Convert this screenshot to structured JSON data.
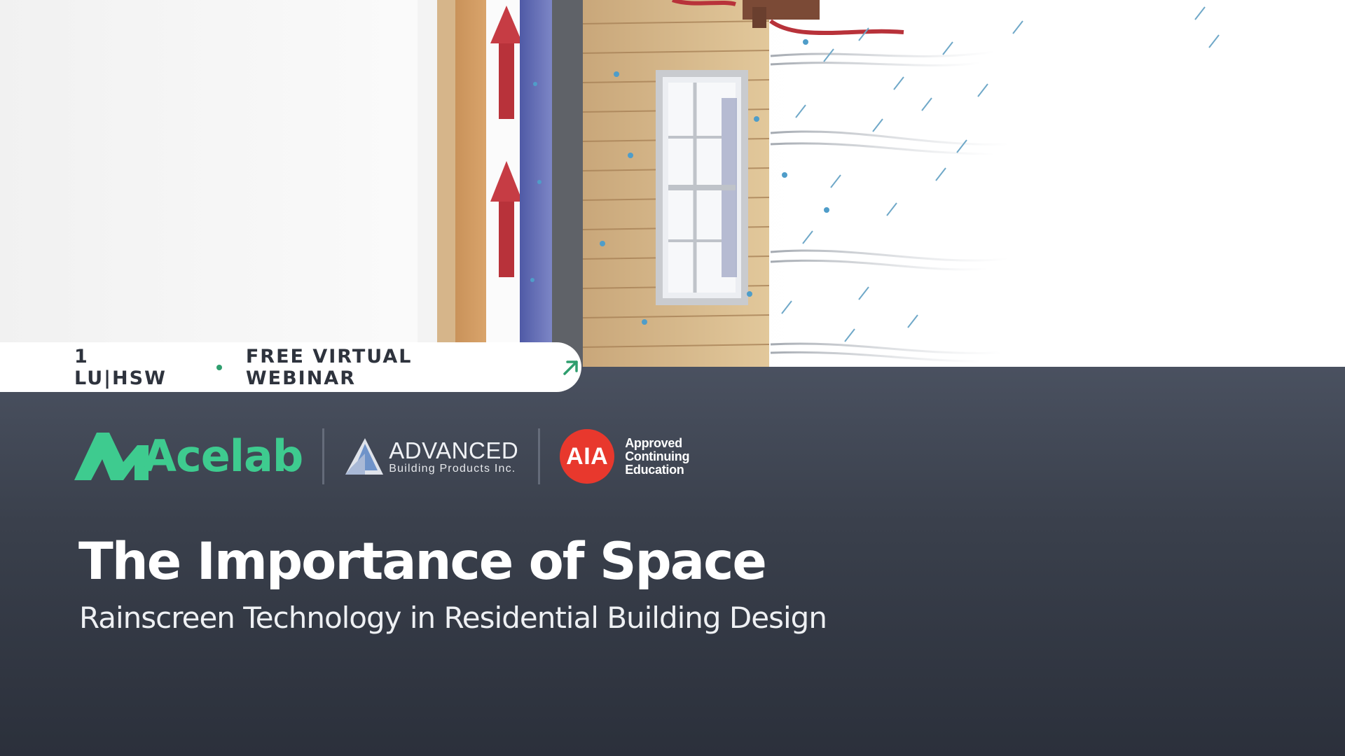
{
  "banner": {
    "credit_label": "1 LU|HSW",
    "event_label": "FREE VIRTUAL WEBINAR",
    "arrow_icon": "arrow-up-right-icon",
    "accent_color": "#2f9e6e"
  },
  "logos": {
    "acelab": {
      "name": "Acelab",
      "color": "#3ecb8f"
    },
    "abp": {
      "title": "ADVANCED",
      "subtitle": "Building Products Inc."
    },
    "aia": {
      "mark": "AIA",
      "line1": "Approved",
      "line2": "Continuing",
      "line3": "Education",
      "color": "#e8382d"
    }
  },
  "headline": {
    "title": "The Importance of Space",
    "subtitle": "Rainscreen Technology in Residential Building Design"
  }
}
